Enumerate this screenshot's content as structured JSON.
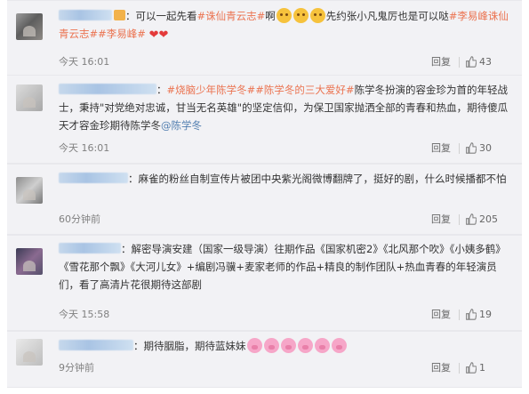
{
  "comments": [
    {
      "parts": [
        {
          "t": "text",
          "v": "："
        },
        {
          "t": "text",
          "v": "可以一起先看"
        },
        {
          "t": "link",
          "v": "#诛仙青云志#"
        },
        {
          "t": "text",
          "v": "啊"
        }
      ],
      "tail_parts": [
        {
          "t": "text",
          "v": "先约张小凡鬼厉也是可以哒"
        },
        {
          "t": "link",
          "v": "#李易峰诛仙青云志#"
        },
        {
          "t": "link",
          "v": "#李易峰#"
        }
      ],
      "time": "今天 16:01",
      "reply": "回复",
      "likes": "43"
    },
    {
      "parts_a": [
        {
          "t": "text",
          "v": "："
        },
        {
          "t": "link",
          "v": "#烧脑少年陈学冬#"
        },
        {
          "t": "link",
          "v": "#陈学冬的三大爱好#"
        },
        {
          "t": "text",
          "v": "陈学冬扮演的容金珍为首的年轻战士，秉持\"对党绝对忠诚，甘当无名英雄\"的坚定信仰，为保卫国家抛洒全部的青春和热血，期待傻瓜天才容金珍期待陈学冬"
        },
        {
          "t": "blue",
          "v": "@陈学冬"
        }
      ],
      "time": "今天 16:01",
      "reply": "回复",
      "likes": "30"
    },
    {
      "text": "：麻雀的粉丝自制宣传片被团中央紫光阁微博翻牌了，挺好的剧，什么时候播都不怕",
      "time": "60分钟前",
      "reply": "回复",
      "likes": "205"
    },
    {
      "text": "：解密导演安建（国家一级导演）往期作品《国家机密2》《北风那个吹》《小姨多鹤》《雪花那个飘》《大河儿女》+编剧冯骥+麦家老师的作品+精良的制作团队+热血青春的年轻演员们，看了高清片花很期待这部剧",
      "time": "今天 15:58",
      "reply": "回复",
      "likes": "19"
    },
    {
      "text": "：期待胭脂，期待蓝妹妹",
      "time": "9分钟前",
      "reply": "回复",
      "likes": "1"
    }
  ],
  "icons": {
    "like": "thumbs-up-icon",
    "avatar": "avatar",
    "cat": "cat-emoji",
    "pig": "pig-emoji",
    "heart": "heart-emoji"
  },
  "colors": {
    "topic": "#eb7350",
    "mention": "#507daf",
    "card_bg": "#f2f2f5"
  }
}
